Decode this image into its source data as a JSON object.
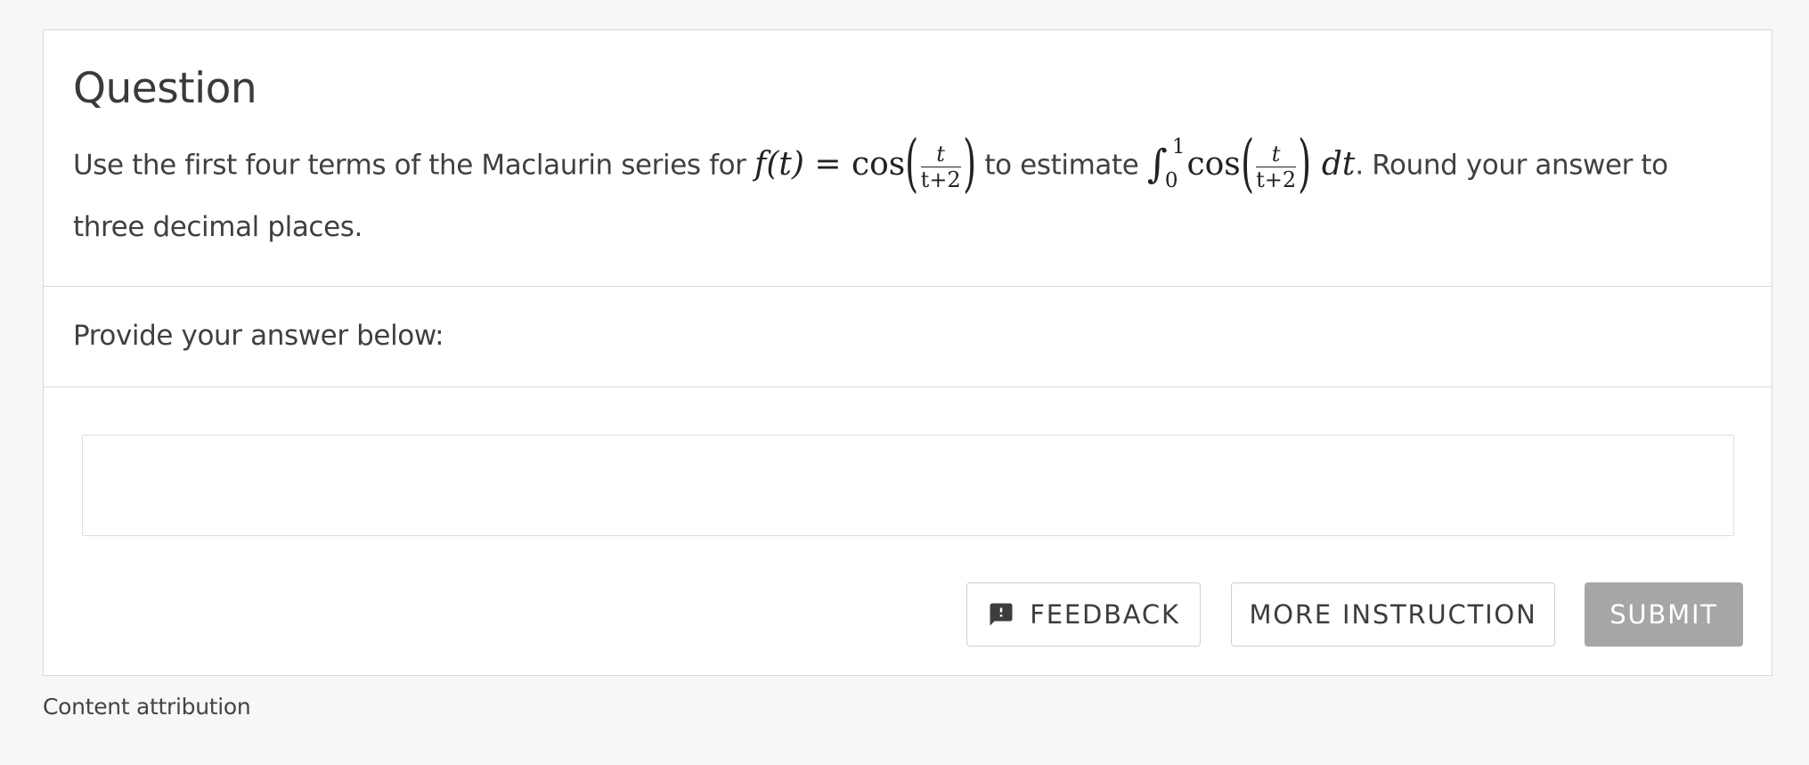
{
  "question": {
    "title": "Question",
    "text_before": "Use the first four terms of the Maclaurin series for",
    "fn_lhs": "f(t) =",
    "cos": "cos",
    "frac_num": "t",
    "frac_den": "t+2",
    "text_middle": "to estimate",
    "int_upper": "1",
    "int_lower": "0",
    "dt": "dt",
    "text_after": ". Round your answer to",
    "text_line2": "three decimal places."
  },
  "answer": {
    "prompt": "Provide your answer below:",
    "input_value": "",
    "input_placeholder": ""
  },
  "buttons": {
    "feedback": "FEEDBACK",
    "more_instruction": "MORE INSTRUCTION",
    "submit": "SUBMIT",
    "feedback_icon": "feedback-icon"
  },
  "footer": {
    "attribution": "Content attribution"
  },
  "colors": {
    "page_bg": "#f7f7f7",
    "card_bg": "#ffffff",
    "border": "#d9d9d9",
    "submit_bg": "#a6a6a6",
    "text": "#404040"
  }
}
